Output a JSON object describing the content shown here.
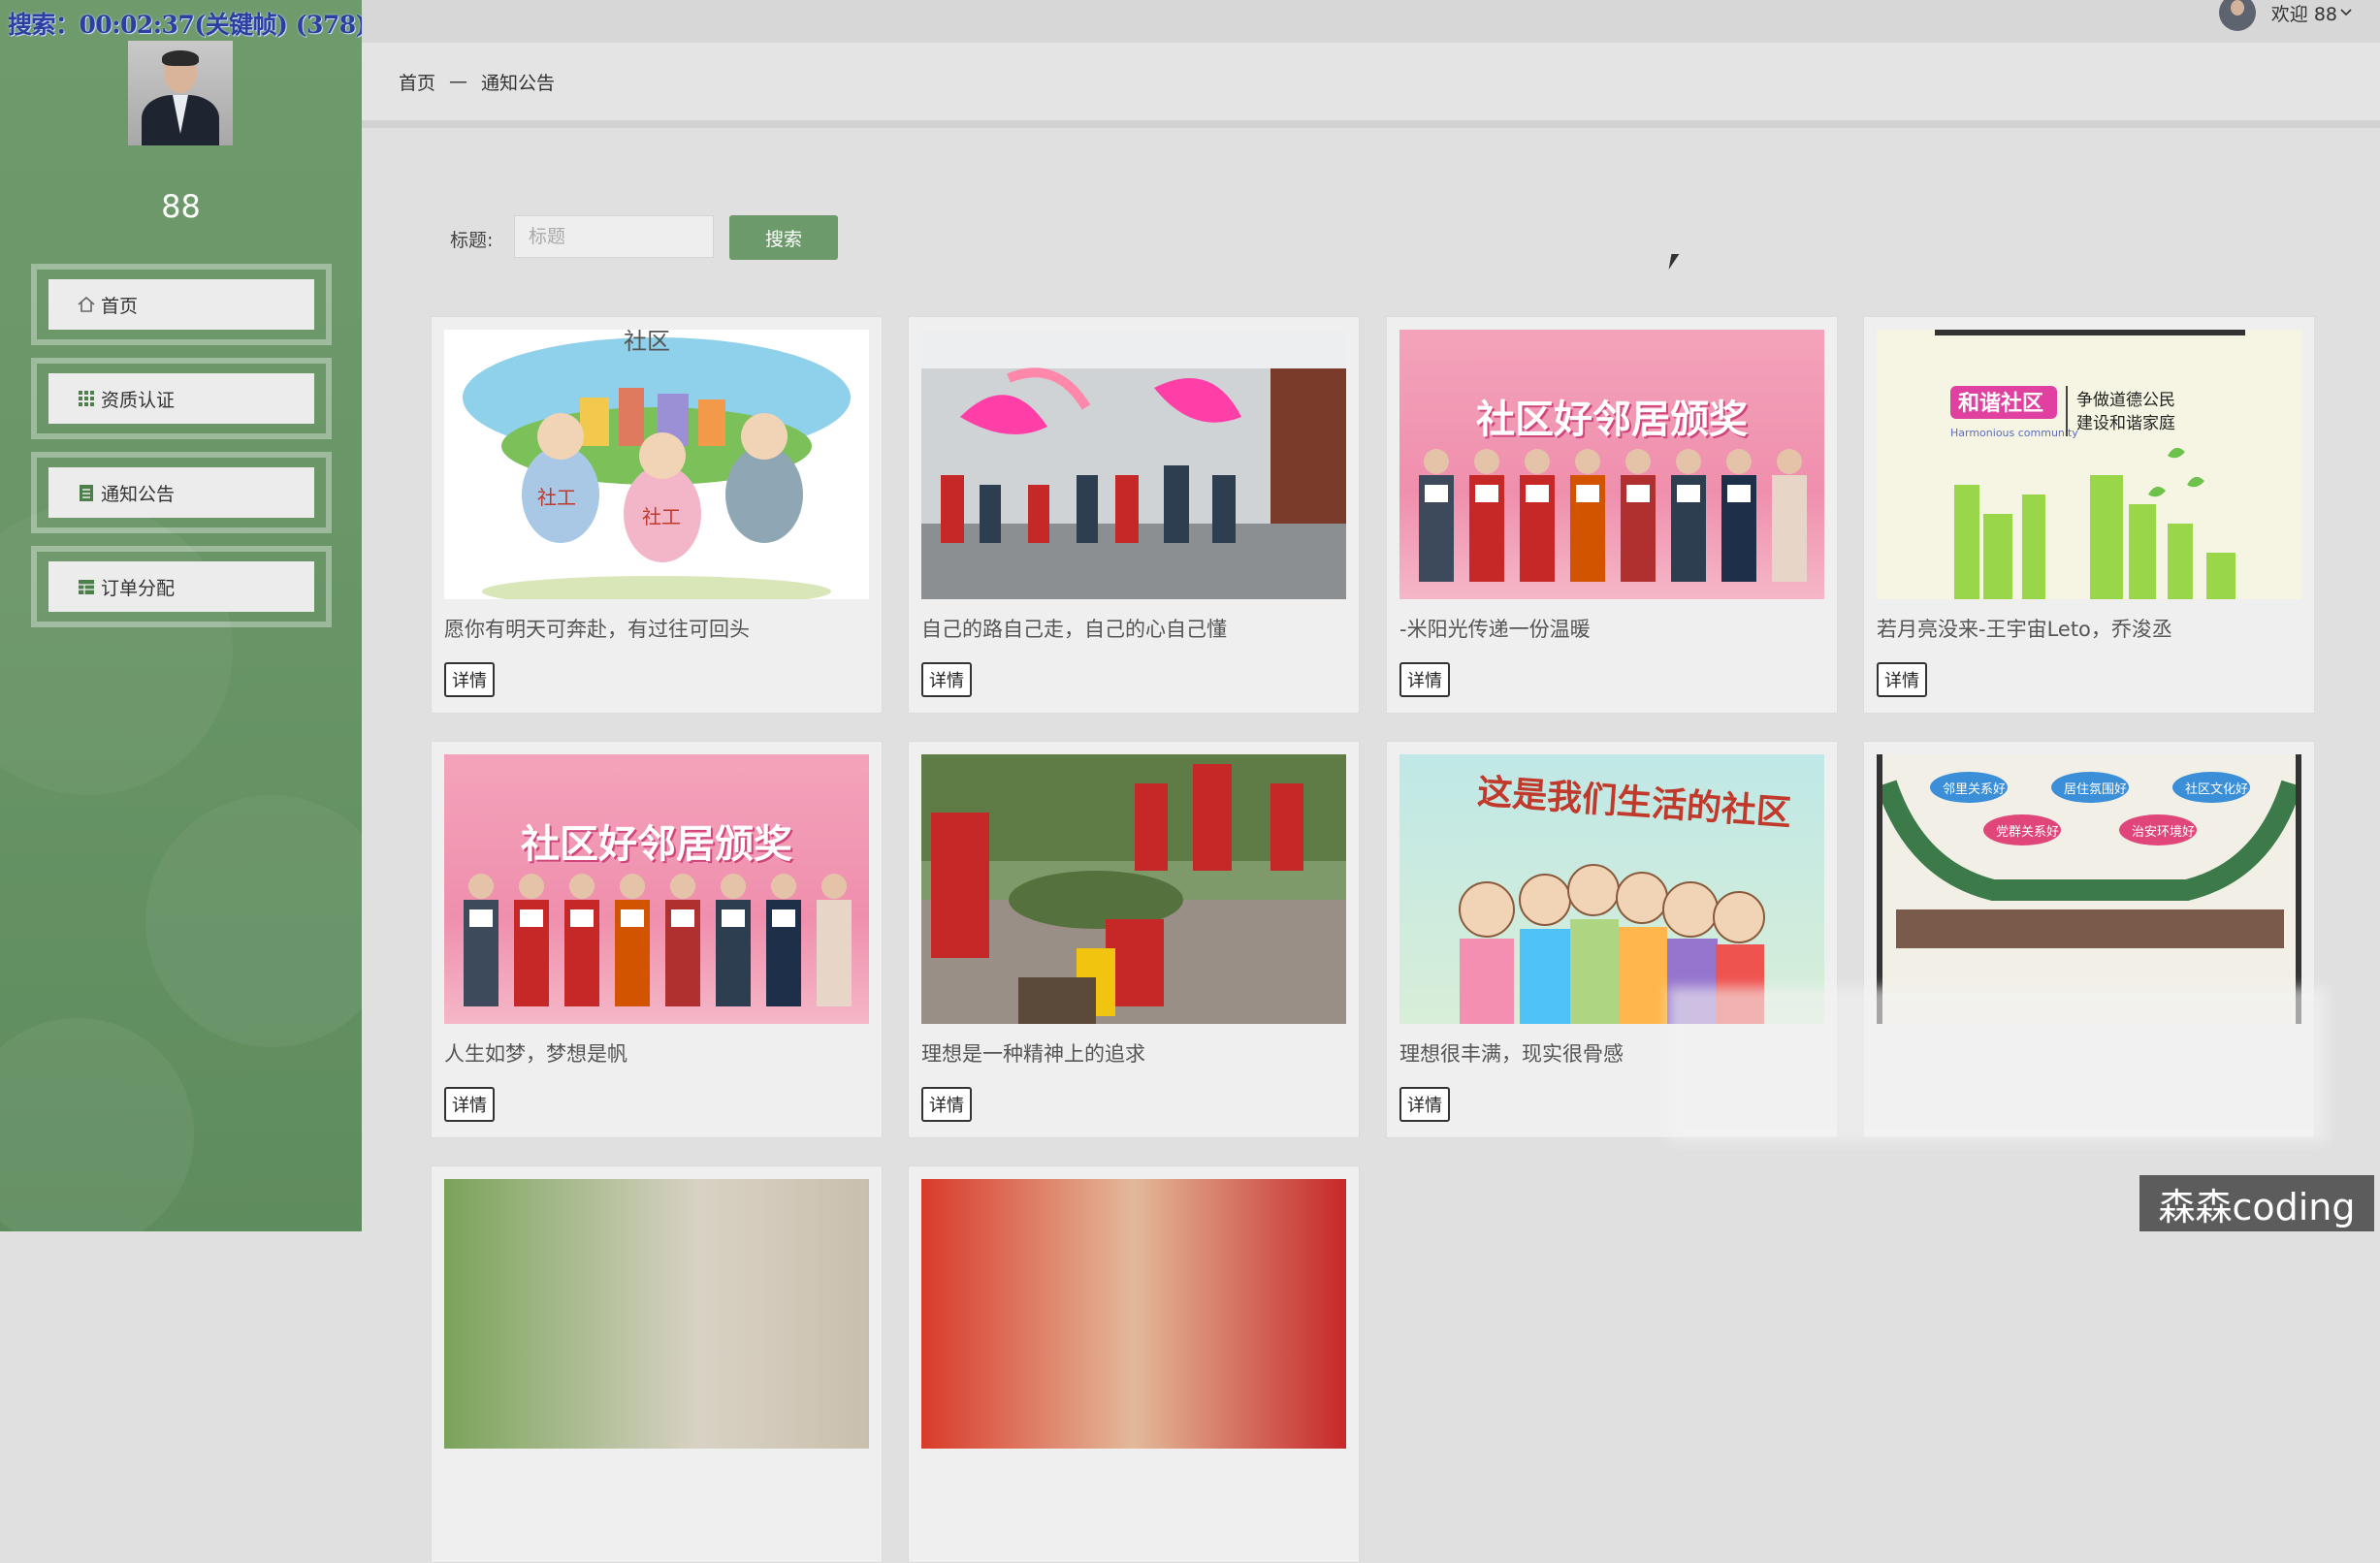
{
  "overlay": {
    "timer_text": "搜索：00:02:37(关键帧) (378)"
  },
  "sidebar": {
    "username": "88",
    "items": [
      {
        "label": "首页",
        "icon": "home-icon"
      },
      {
        "label": "资质认证",
        "icon": "grid-icon"
      },
      {
        "label": "通知公告",
        "icon": "notice-icon"
      },
      {
        "label": "订单分配",
        "icon": "table-icon"
      }
    ]
  },
  "topbar": {
    "welcome": "欢迎 88"
  },
  "breadcrumb": {
    "home": "首页",
    "separator": "—",
    "current": "通知公告"
  },
  "search": {
    "label": "标题:",
    "placeholder": "标题",
    "button": "搜索"
  },
  "cards": [
    {
      "title": "愿你有明天可奔赴，有过往可回头",
      "detail": "详情",
      "image": "community-cartoon"
    },
    {
      "title": "自己的路自己走，自己的心自己懂",
      "detail": "详情",
      "image": "fan-dance-photo"
    },
    {
      "title": "-米阳光传递一份温暖",
      "detail": "详情",
      "image": "neighbor-award-photo"
    },
    {
      "title": "若月亮没来-王宇宙Leto，乔浚丞",
      "detail": "详情",
      "image": "harmonious-community-poster"
    },
    {
      "title": "人生如梦，梦想是帆",
      "detail": "详情",
      "image": "neighbor-award-photo"
    },
    {
      "title": "理想是一种精神上的追求",
      "detail": "详情",
      "image": "volunteer-cleanup-photo"
    },
    {
      "title": "理想很丰满，现实很骨感",
      "detail": "详情",
      "image": "our-community-cartoon"
    },
    {
      "title": "",
      "detail": "",
      "image": "community-board"
    },
    {
      "title": "",
      "detail": "",
      "image": "building-photo"
    },
    {
      "title": "",
      "detail": "",
      "image": "red-flag-photo"
    }
  ],
  "images_text": {
    "cartoon_sign": "社区",
    "cartoon_worker": "社工",
    "award_banner": "社区好邻居颁奖",
    "harmony_badge": "和谐社区",
    "harmony_slogan_1": "争做道德公民",
    "harmony_slogan_2": "建设和谐家庭",
    "harmony_english": "Harmonious community",
    "our_community": "这是我们生活的社区",
    "board_tags": [
      "邻里关系好",
      "居住氛围好",
      "社区文化好",
      "党群关系好",
      "治安环境好"
    ]
  },
  "watermark": "森森coding",
  "colors": {
    "sidebar": "#6a9668",
    "accent_button": "#6c9a6a",
    "background": "#e0e0e0"
  }
}
